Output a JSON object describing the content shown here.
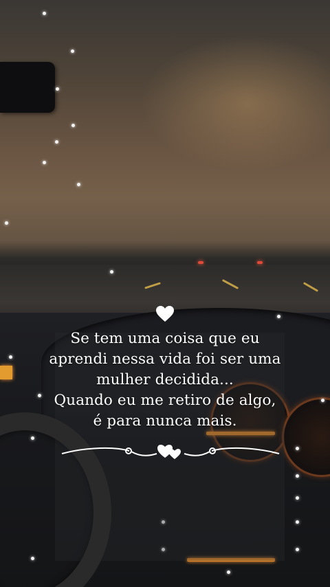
{
  "quote": {
    "lines": [
      "Se tem uma coisa que eu",
      "aprendi nessa vida foi ser uma",
      "mulher decidida...",
      "Quando eu me retiro de algo,",
      "é para nunca mais."
    ]
  },
  "icons": {
    "top": "heart-icon",
    "divider": "ornamental-divider-with-hearts"
  },
  "colors": {
    "text": "#ffffff",
    "sky": "#6a5543",
    "gauge": "#e28a2a"
  }
}
